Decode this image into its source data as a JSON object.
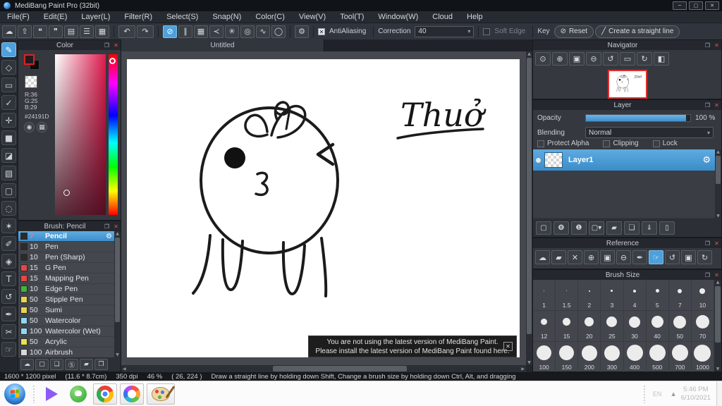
{
  "window": {
    "title": "MediBang Paint Pro (32bit)",
    "controls": [
      {
        "glyph": "─",
        "name": "minimize-button"
      },
      {
        "glyph": "▢",
        "name": "maximize-button"
      },
      {
        "glyph": "✕",
        "name": "close-button"
      }
    ]
  },
  "icons": {
    "detach": "❐",
    "close": "✕",
    "chevron": "▾",
    "check_mark": "✕",
    "up": "▲",
    "down": "▼",
    "left": "◀",
    "right": "▶"
  },
  "menubar": {
    "items": [
      "File(F)",
      "Edit(E)",
      "Layer(L)",
      "Filter(R)",
      "Select(S)",
      "Snap(N)",
      "Color(C)",
      "View(V)",
      "Tool(T)",
      "Window(W)",
      "Cloud",
      "Help"
    ]
  },
  "toolbar": {
    "file_icons": [
      {
        "glyph": "☁",
        "name": "cloud-save-icon"
      },
      {
        "glyph": "⇧",
        "name": "publish-icon"
      },
      {
        "glyph": "❝",
        "name": "comment-icon"
      },
      {
        "glyph": "❞",
        "name": "chat-icon"
      },
      {
        "glyph": "▤",
        "name": "document-icon"
      },
      {
        "glyph": "☰",
        "name": "list-settings-icon"
      },
      {
        "glyph": "▦",
        "name": "material-grid-icon"
      }
    ],
    "undo": {
      "glyph": "↶",
      "name": "undo-button"
    },
    "redo": {
      "glyph": "↷",
      "name": "redo-button"
    },
    "snap_icons": [
      {
        "glyph": "⊘",
        "name": "snap-off-button",
        "state": "sel"
      },
      {
        "glyph": "∥",
        "name": "snap-parallel-button"
      },
      {
        "glyph": "▦",
        "name": "snap-grid-button"
      },
      {
        "glyph": "≺",
        "name": "snap-vanishing-point-button"
      },
      {
        "glyph": "✳",
        "name": "snap-radial-button"
      },
      {
        "glyph": "◎",
        "name": "snap-concentric-button"
      },
      {
        "glyph": "∿",
        "name": "snap-curve-button"
      },
      {
        "glyph": "◯",
        "name": "snap-ellipse-button"
      }
    ],
    "snap_settings_glyph": "⚙",
    "antialiasing_label": "AntiAliasing",
    "correction_label": "Correction",
    "correction_value": "40",
    "soft_edge_label": "Soft Edge",
    "key_label": "Key",
    "reset_label": "Reset",
    "reset_glyph": "⊘",
    "straight_line_label": "Create a straight line",
    "straight_line_glyph": "╱"
  },
  "tools": [
    {
      "glyph": "✎",
      "name": "brush-tool",
      "state": "sel"
    },
    {
      "glyph": "◇",
      "name": "eraser-tool"
    },
    {
      "glyph": "▭",
      "name": "figure-tool"
    },
    {
      "glyph": "✓",
      "name": "control-point-tool"
    },
    {
      "glyph": "✛",
      "name": "move-tool"
    },
    {
      "glyph": "■",
      "name": "fill-tool"
    },
    {
      "glyph": "◪",
      "name": "bucket-tool"
    },
    {
      "glyph": "▧",
      "name": "gradient-tool"
    },
    {
      "glyph": "▢",
      "name": "select-tool"
    },
    {
      "glyph": "◌",
      "name": "lasso-tool"
    },
    {
      "glyph": "✶",
      "name": "magic-wand-tool"
    },
    {
      "glyph": "✐",
      "name": "select-pen-tool"
    },
    {
      "glyph": "◈",
      "name": "select-eraser-tool"
    },
    {
      "glyph": "T",
      "name": "text-tool"
    },
    {
      "glyph": "↺",
      "name": "operation-tool"
    },
    {
      "glyph": "✒",
      "name": "eyedropper-tool"
    },
    {
      "glyph": "✂",
      "name": "divide-tool"
    },
    {
      "glyph": "☞",
      "name": "hand-tool"
    }
  ],
  "color_panel": {
    "title": "Color",
    "r": "R:36",
    "g": "G:25",
    "b": "B:29",
    "hex": "#24191D",
    "fg_hex": "#24191D",
    "wheel_glyph": "◉",
    "palette_glyph": "▦"
  },
  "brush_panel": {
    "title": "Brush: Pencil",
    "gear": "⚙",
    "brushes": [
      {
        "num": "7",
        "name": "Pencil",
        "swatch": "#2b2b2b",
        "state": "selected",
        "numColor": "#e8799a"
      },
      {
        "num": "10",
        "name": "Pen",
        "swatch": "#2b2b2b"
      },
      {
        "num": "10",
        "name": "Pen (Sharp)",
        "swatch": "#2b2b2b"
      },
      {
        "num": "15",
        "name": "G Pen",
        "swatch": "#e84545"
      },
      {
        "num": "15",
        "name": "Mapping Pen",
        "swatch": "#e84545"
      },
      {
        "num": "10",
        "name": "Edge Pen",
        "swatch": "#3fb53f"
      },
      {
        "num": "50",
        "name": "Stipple Pen",
        "swatch": "#e8d44f"
      },
      {
        "num": "50",
        "name": "Sumi",
        "swatch": "#e8d44f"
      },
      {
        "num": "50",
        "name": "Watercolor",
        "swatch": "#8fd8f2"
      },
      {
        "num": "100",
        "name": "Watercolor (Wet)",
        "swatch": "#8fd8f2"
      },
      {
        "num": "50",
        "name": "Acrylic",
        "swatch": "#e8e04f"
      },
      {
        "num": "100",
        "name": "Airbrush",
        "swatch": "#d8d8d8"
      }
    ],
    "bottom_icons": [
      {
        "glyph": "☁",
        "name": "add-cloud-brush-button"
      },
      {
        "glyph": "▢",
        "name": "add-brush-button"
      },
      {
        "glyph": "❏",
        "name": "add-brush-menu-button"
      },
      {
        "glyph": "Ⓢ",
        "name": "script-brush-button"
      },
      {
        "glyph": "▰",
        "name": "brush-folder-button"
      },
      {
        "glyph": "❐",
        "name": "duplicate-brush-button"
      }
    ]
  },
  "canvas": {
    "tab": "Untitled",
    "handwriting": "Thuở",
    "notification_line1": "You are not using the latest version of MediBang Paint.",
    "notification_line2": "Please install the latest version of MediBang Paint found here.",
    "notification_close": "✕"
  },
  "navigator": {
    "title": "Navigator",
    "icons": [
      {
        "glyph": "⊙",
        "name": "zoom-actual-button"
      },
      {
        "glyph": "⊕",
        "name": "zoom-in-button"
      },
      {
        "glyph": "▣",
        "name": "fit-screen-button"
      },
      {
        "glyph": "⊖",
        "name": "zoom-out-button"
      },
      {
        "glyph": "↺",
        "name": "rotate-left-button"
      },
      {
        "glyph": "▭",
        "name": "reset-rotation-button"
      },
      {
        "glyph": "↻",
        "name": "rotate-right-button"
      },
      {
        "glyph": "◧",
        "name": "flip-horizontal-button"
      }
    ]
  },
  "layer_panel": {
    "title": "Layer",
    "opacity_label": "Opacity",
    "opacity_value": "100 %",
    "blending_label": "Blending",
    "blending_value": "Normal",
    "checks": [
      {
        "label": "Protect Alpha",
        "name": "protect-alpha-checkbox"
      },
      {
        "label": "Clipping",
        "name": "clipping-checkbox",
        "state": "dim"
      },
      {
        "label": "Lock",
        "name": "lock-checkbox"
      }
    ],
    "layer_name": "Layer1",
    "gear": "⚙",
    "bottom_icons": [
      {
        "glyph": "▢",
        "name": "add-layer-button"
      },
      {
        "glyph": "❽",
        "name": "add-8bit-layer-button"
      },
      {
        "glyph": "❶",
        "name": "add-1bit-layer-button"
      },
      {
        "glyph": "▢▾",
        "name": "add-layer-menu-button"
      },
      {
        "glyph": "▰",
        "name": "layer-folder-button"
      },
      {
        "glyph": "❏",
        "name": "duplicate-layer-button"
      },
      {
        "glyph": "⇓",
        "name": "merge-layer-button"
      },
      {
        "glyph": "▯",
        "name": "delete-layer-button"
      }
    ]
  },
  "reference": {
    "title": "Reference",
    "icons": [
      {
        "glyph": "☁",
        "name": "ref-cloud-button"
      },
      {
        "glyph": "▰",
        "name": "ref-open-button"
      },
      {
        "glyph": "✕",
        "name": "ref-clear-button"
      },
      {
        "glyph": "⊕",
        "name": "ref-zoom-in-button"
      },
      {
        "glyph": "▣",
        "name": "ref-fit-button"
      },
      {
        "glyph": "⊖",
        "name": "ref-zoom-out-button"
      },
      {
        "glyph": "✒",
        "name": "ref-eyedropper-button"
      },
      {
        "glyph": "☞",
        "name": "ref-hand-button",
        "state": "sel"
      },
      {
        "glyph": "↺",
        "name": "ref-rotate-left-button"
      },
      {
        "glyph": "▣",
        "name": "ref-reset-rotation-button"
      },
      {
        "glyph": "↻",
        "name": "ref-rotate-right-button"
      }
    ]
  },
  "brush_size": {
    "title": "Brush Size",
    "sizes": [
      {
        "label": "1",
        "d": "1px"
      },
      {
        "label": "1.5",
        "d": "1px"
      },
      {
        "label": "2",
        "d": "2px"
      },
      {
        "label": "3",
        "d": "3px"
      },
      {
        "label": "4",
        "d": "4px"
      },
      {
        "label": "5",
        "d": "5px"
      },
      {
        "label": "7",
        "d": "6px"
      },
      {
        "label": "10",
        "d": "8px"
      },
      {
        "label": "12",
        "d": "9px"
      },
      {
        "label": "15",
        "d": "11px"
      },
      {
        "label": "20",
        "d": "13px"
      },
      {
        "label": "25",
        "d": "15px"
      },
      {
        "label": "30",
        "d": "16px"
      },
      {
        "label": "40",
        "d": "17px"
      },
      {
        "label": "50",
        "d": "18px"
      },
      {
        "label": "70",
        "d": "19px"
      },
      {
        "label": "100",
        "d": "21px"
      },
      {
        "label": "150",
        "d": "21px"
      },
      {
        "label": "200",
        "d": "22px"
      },
      {
        "label": "300",
        "d": "22px"
      },
      {
        "label": "400",
        "d": "23px"
      },
      {
        "label": "500",
        "d": "23px"
      },
      {
        "label": "700",
        "d": "23px"
      },
      {
        "label": "1000",
        "d": "24px"
      }
    ]
  },
  "status_bar": {
    "parts": [
      "1600 * 1200 pixel",
      "(11.6 * 8.7cm)",
      "350 dpi",
      "46 %",
      "( 26, 224 )",
      "Draw a straight line by holding down Shift, Change a brush size by holding down Ctrl, Alt, and dragging"
    ]
  },
  "taskbar": {
    "tray": {
      "lang": "EN",
      "expand": "▲",
      "time": "5:46 PM",
      "date": "6/10/2021"
    }
  }
}
